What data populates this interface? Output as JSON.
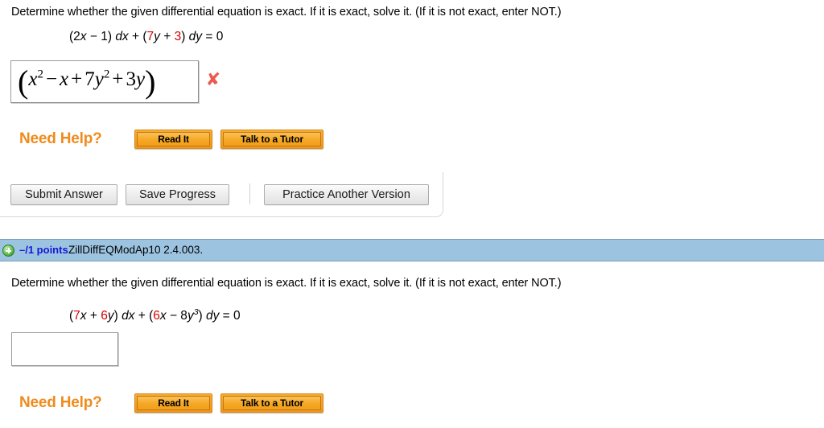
{
  "problem1": {
    "prompt": "Determine whether the given differential equation is exact. If it is exact, solve it. (If it is not exact, enter NOT.)",
    "equation": {
      "text": "(2x − 1) dx + (7y + 3) dy = 0",
      "parts": [
        {
          "t": "(2",
          "style": "plain"
        },
        {
          "t": "x",
          "style": "italic"
        },
        {
          "t": " − 1) ",
          "style": "plain"
        },
        {
          "t": "dx",
          "style": "italic"
        },
        {
          "t": " + (",
          "style": "plain"
        },
        {
          "t": "7",
          "style": "red"
        },
        {
          "t": "y",
          "style": "italic"
        },
        {
          "t": " + ",
          "style": "plain"
        },
        {
          "t": "3",
          "style": "red"
        },
        {
          "t": ") ",
          "style": "plain"
        },
        {
          "t": "dy",
          "style": "italic"
        },
        {
          "t": " = 0",
          "style": "plain"
        }
      ]
    },
    "answer_value": "(x^2 − x + 7y^2 + 3y)",
    "answer_status": "incorrect",
    "answer_status_icon": "red-x-icon",
    "need_help_label": "Need Help?",
    "read_it_label": "Read It",
    "talk_to_tutor_label": "Talk to a Tutor",
    "submit_label": "Submit Answer",
    "save_label": "Save Progress",
    "practice_label": "Practice Another Version"
  },
  "problem2": {
    "points_icon": "plus-circle-icon",
    "points_label": "–/1 points",
    "reference": "ZillDiffEQModAp10 2.4.003.",
    "prompt": "Determine whether the given differential equation is exact. If it is exact, solve it. (If it is not exact, enter NOT.)",
    "equation": {
      "text": "(7x + 6y) dx + (6x − 8y^3) dy = 0"
    },
    "answer_value": "",
    "need_help_label": "Need Help?",
    "read_it_label": "Read It",
    "talk_to_tutor_label": "Talk to a Tutor"
  },
  "colors": {
    "accent_orange": "#f08b1d",
    "points_blue": "#1616d8",
    "bar_blue": "#9cc4e1",
    "equation_red": "#d60000",
    "incorrect_red": "#ea5b4f"
  }
}
